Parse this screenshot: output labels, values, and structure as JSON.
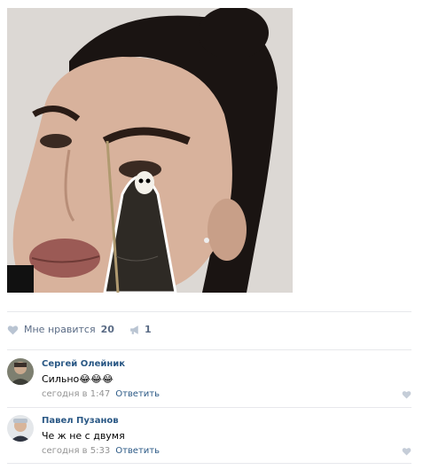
{
  "post": {
    "likes_label": "Мне нравится",
    "likes_count": "20",
    "shares_count": "1"
  },
  "comments": [
    {
      "author": "Сергей Олейник",
      "text": "Сильно😂😂😂",
      "time": "сегодня в 1:47",
      "reply_label": "Ответить"
    },
    {
      "author": "Павел Пузанов",
      "text": "Че ж не с двумя",
      "time": "сегодня в 5:33",
      "reply_label": "Ответить"
    }
  ],
  "colors": {
    "link": "#2a5885",
    "action": "#5a6b85",
    "muted": "#939393",
    "divider": "#e7e8ec"
  },
  "icons": [
    "heart-icon",
    "megaphone-icon"
  ]
}
